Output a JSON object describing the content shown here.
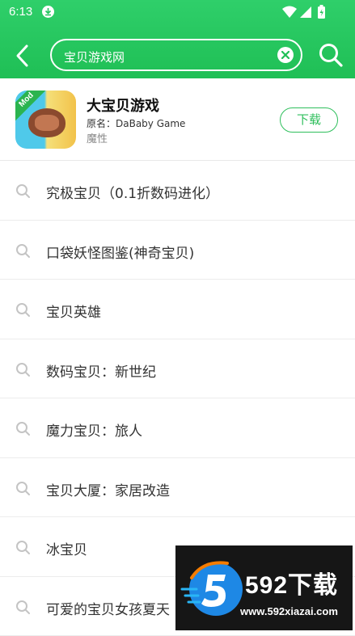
{
  "status_bar": {
    "time": "6:13"
  },
  "search": {
    "query": "宝贝游戏网"
  },
  "app_card": {
    "name": "大宝贝游戏",
    "original_name": "原名：DaBaby Game",
    "tag": "魔性",
    "badge": "Mod",
    "download_label": "下载"
  },
  "suggestions": [
    "究极宝贝（0.1折数码进化）",
    "口袋妖怪图鉴(神奇宝贝)",
    "宝贝英雄",
    "数码宝贝：新世纪",
    "魔力宝贝：旅人",
    "宝贝大厦：家居改造",
    "冰宝贝",
    "可爱的宝贝女孩夏天"
  ],
  "watermark": {
    "title": "592下载",
    "url": "www.592xiazai.com"
  },
  "colors": {
    "accent": "#22c55e",
    "header_green": "#1fbf55"
  }
}
